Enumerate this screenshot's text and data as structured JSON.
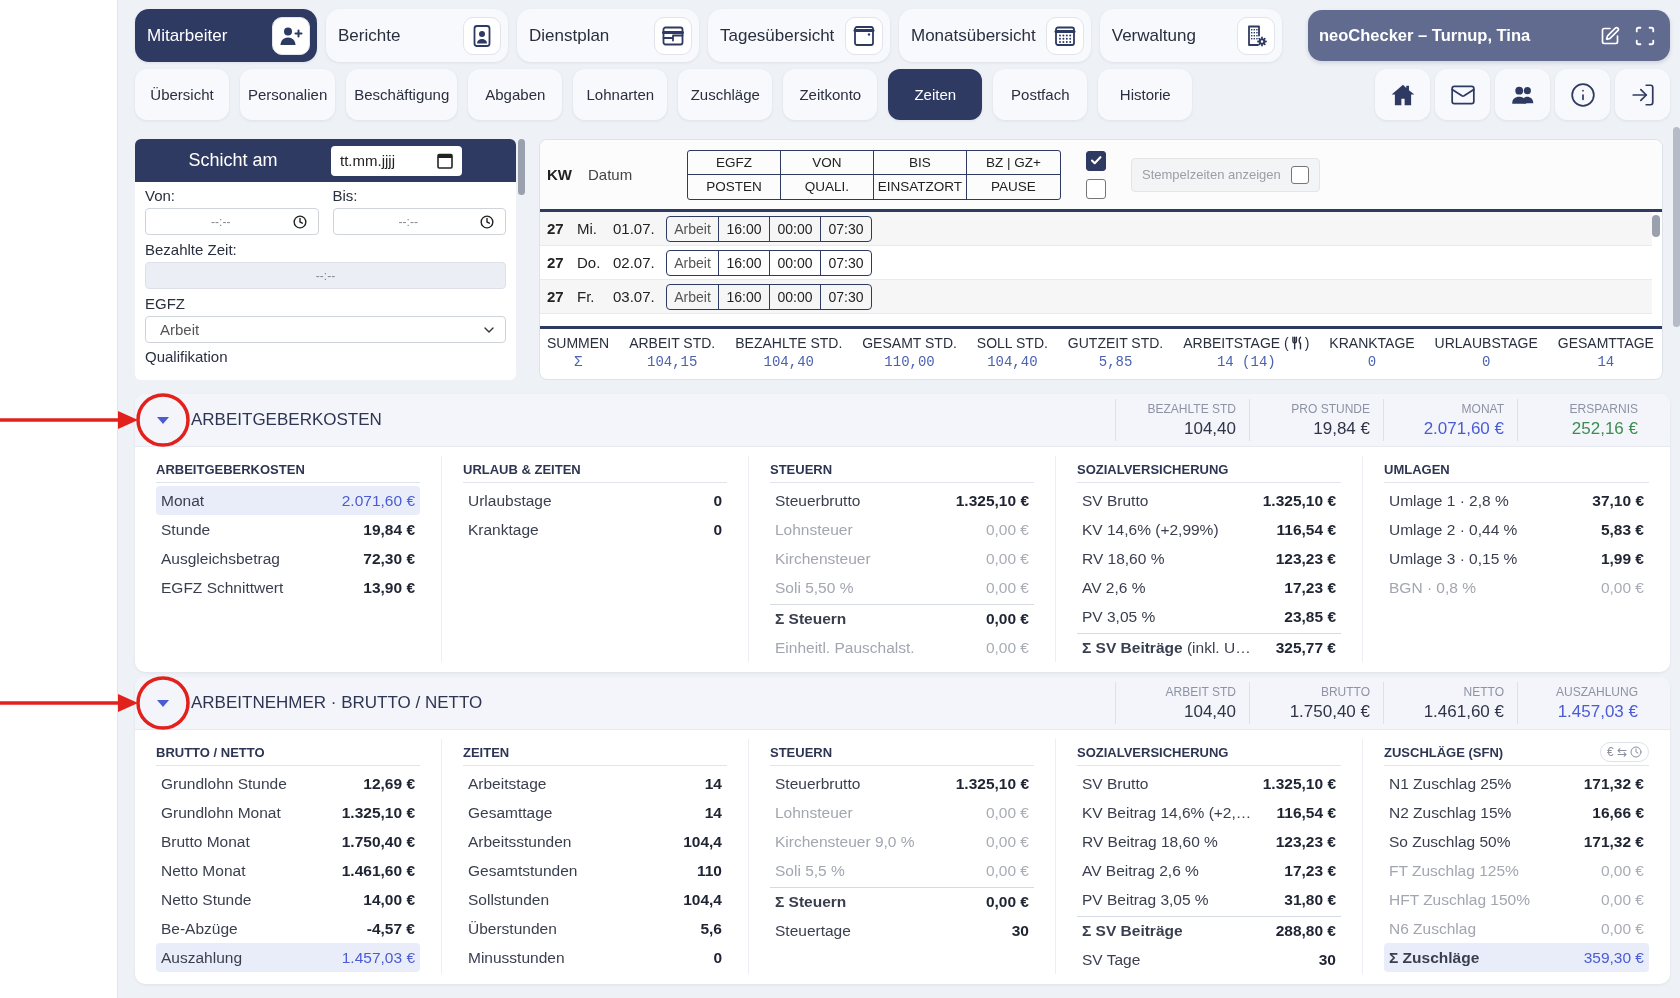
{
  "top_nav": [
    {
      "label": "Mitarbeiter",
      "selected": true
    },
    {
      "label": "Berichte",
      "selected": false
    },
    {
      "label": "Dienstplan",
      "selected": false
    },
    {
      "label": "Tagesübersicht",
      "selected": false
    },
    {
      "label": "Monatsübersicht",
      "selected": false
    },
    {
      "label": "Verwaltung",
      "selected": false
    }
  ],
  "app_panel": {
    "title": "neoChecker – Turnup, Tina"
  },
  "sub_tabs": [
    {
      "label": "Übersicht",
      "selected": false
    },
    {
      "label": "Personalien",
      "selected": false
    },
    {
      "label": "Beschäftigung",
      "selected": false
    },
    {
      "label": "Abgaben",
      "selected": false
    },
    {
      "label": "Lohnarten",
      "selected": false
    },
    {
      "label": "Zuschläge",
      "selected": false
    },
    {
      "label": "Zeitkonto",
      "selected": false
    },
    {
      "label": "Zeiten",
      "selected": true
    },
    {
      "label": "Postfach",
      "selected": false
    },
    {
      "label": "Historie",
      "selected": false
    }
  ],
  "shift_form": {
    "title": "Schicht am",
    "date": {
      "placeholder": "tt.mm.jjjj"
    },
    "from": {
      "label": "Von:",
      "placeholder": "--:--"
    },
    "to": {
      "label": "Bis:",
      "placeholder": "--:--"
    },
    "paid_time": {
      "label": "Bezahlte Zeit:",
      "placeholder": "--:--",
      "disabled": true
    },
    "egfz": {
      "label": "EGFZ",
      "value": "Arbeit"
    },
    "qualification": {
      "label": "Qualifikation"
    }
  },
  "shift_table": {
    "kw_label": "KW",
    "date_label": "Datum",
    "header_grid": [
      [
        "EGFZ",
        "VON",
        "BIS",
        "BZ | GZ+"
      ],
      [
        "POSTEN",
        "QUALI.",
        "EINSATZORT",
        "PAUSE"
      ]
    ],
    "header_checks": [
      {
        "checked": true
      },
      {
        "checked": false
      }
    ],
    "stamp_toggle": {
      "label": "Stempelzeiten anzeigen",
      "checked": false,
      "disabled": true
    },
    "rows": [
      {
        "kw": "27",
        "weekday": "Mi.",
        "date": "01.07.",
        "cells": [
          "Arbeit",
          "16:00",
          "00:00",
          "07:30"
        ]
      },
      {
        "kw": "27",
        "weekday": "Do.",
        "date": "02.07.",
        "cells": [
          "Arbeit",
          "16:00",
          "00:00",
          "07:30"
        ]
      },
      {
        "kw": "27",
        "weekday": "Fr.",
        "date": "03.07.",
        "cells": [
          "Arbeit",
          "16:00",
          "00:00",
          "07:30"
        ]
      }
    ],
    "sums": {
      "label": "SUMMEN",
      "symbol": "Σ",
      "columns": [
        {
          "label": "ARBEIT STD.",
          "value": "104,15"
        },
        {
          "label": "BEZAHLTE STD.",
          "value": "104,40"
        },
        {
          "label": "GESAMT STD.",
          "value": "110,00"
        },
        {
          "label": "SOLL STD.",
          "value": "104,40"
        },
        {
          "label": "GUTZEIT STD.",
          "value": "5,85"
        },
        {
          "label": "ARBEITSTAGE (",
          "label_end": ")",
          "has_icon": true,
          "value": "14 (14)"
        },
        {
          "label": "KRANKTAGE",
          "value": "0"
        },
        {
          "label": "URLAUBSTAGE",
          "value": "0"
        },
        {
          "label": "GESAMTTAGE",
          "value": "14"
        }
      ]
    }
  },
  "sections": [
    {
      "title": "ARBEITGEBERKOSTEN",
      "expanded": true,
      "highlighted": true,
      "summary": [
        {
          "label": "BEZAHLTE STD",
          "value": "104,40",
          "color": "#2f3447"
        },
        {
          "label": "PRO STUNDE",
          "value": "19,84 €",
          "color": "#2f3447"
        },
        {
          "label": "MONAT",
          "value": "2.071,60 €",
          "color": "#4a5bd4"
        },
        {
          "label": "ERSPARNIS",
          "value": "252,16 €",
          "color": "#3e8c4f"
        }
      ],
      "groups": [
        {
          "title": "ARBEITGEBERKOSTEN",
          "rows": [
            {
              "label": "Monat",
              "value": "2.071,60 €",
              "kind": "highlight"
            },
            {
              "label": "Stunde",
              "value": "19,84 €",
              "kind": "normal"
            },
            {
              "label": "Ausgleichsbetrag",
              "value": "72,30 €",
              "kind": "normal"
            },
            {
              "label": "EGFZ Schnittwert",
              "value": "13,90 €",
              "kind": "normal"
            }
          ]
        },
        {
          "title": "URLAUB & ZEITEN",
          "rows": [
            {
              "label": "Urlaubstage",
              "value": "0",
              "kind": "normal"
            },
            {
              "label": "Kranktage",
              "value": "0",
              "kind": "normal"
            }
          ]
        },
        {
          "title": "STEUERN",
          "rows": [
            {
              "label": "Steuerbrutto",
              "value": "1.325,10 €",
              "kind": "normal"
            },
            {
              "label": "Lohnsteuer",
              "value": "0,00 €",
              "kind": "muted"
            },
            {
              "label": "Kirchensteuer",
              "value": "0,00 €",
              "kind": "muted"
            },
            {
              "label": "Soli 5,50 %",
              "value": "0,00 €",
              "kind": "muted"
            },
            {
              "label": "Σ Steuern",
              "value": "0,00 €",
              "kind": "total"
            },
            {
              "label": "Einheitl. Pauschalst.",
              "value": "0,00 €",
              "kind": "muted"
            }
          ]
        },
        {
          "title": "SOZIALVERSICHERUNG",
          "rows": [
            {
              "label": "SV Brutto",
              "value": "1.325,10 €",
              "kind": "normal"
            },
            {
              "label": "KV 14,6% (+2,99%)",
              "value": "116,54 €",
              "kind": "normal"
            },
            {
              "label": "RV 18,60 %",
              "value": "123,23 €",
              "kind": "normal"
            },
            {
              "label": "AV 2,6 %",
              "value": "17,23 €",
              "kind": "normal"
            },
            {
              "label": "PV 3,05 %",
              "value": "23,85 €",
              "kind": "normal"
            },
            {
              "label": "Σ SV Beiträge",
              "note": "(inkl. U…",
              "value": "325,77 €",
              "kind": "total"
            }
          ]
        },
        {
          "title": "UMLAGEN",
          "rows": [
            {
              "label": "Umlage 1 · 2,8 %",
              "value": "37,10 €",
              "kind": "normal"
            },
            {
              "label": "Umlage 2 · 0,44 %",
              "value": "5,83 €",
              "kind": "normal"
            },
            {
              "label": "Umlage 3 · 0,15 %",
              "value": "1,99 €",
              "kind": "normal"
            },
            {
              "label": "BGN · 0,8 %",
              "value": "0,00 €",
              "kind": "muted"
            }
          ]
        }
      ]
    },
    {
      "title": "ARBEITNEHMER · BRUTTO / NETTO",
      "expanded": true,
      "highlighted": true,
      "summary": [
        {
          "label": "ARBEIT STD",
          "value": "104,40",
          "color": "#2f3447"
        },
        {
          "label": "BRUTTO",
          "value": "1.750,40 €",
          "color": "#2f3447"
        },
        {
          "label": "NETTO",
          "value": "1.461,60 €",
          "color": "#2f3447"
        },
        {
          "label": "AUSZAHLUNG",
          "value": "1.457,03 €",
          "color": "#4a5bd4"
        }
      ],
      "groups": [
        {
          "title": "BRUTTO / NETTO",
          "rows": [
            {
              "label": "Grundlohn Stunde",
              "value": "12,69 €",
              "kind": "normal"
            },
            {
              "label": "Grundlohn Monat",
              "value": "1.325,10 €",
              "kind": "normal"
            },
            {
              "label": "Brutto Monat",
              "value": "1.750,40 €",
              "kind": "normal"
            },
            {
              "label": "Netto Monat",
              "value": "1.461,60 €",
              "kind": "normal"
            },
            {
              "label": "Netto Stunde",
              "value": "14,00 €",
              "kind": "normal"
            },
            {
              "label": "Be-Abzüge",
              "value": "-4,57 €",
              "kind": "normal"
            },
            {
              "label": "Auszahlung",
              "value": "1.457,03 €",
              "kind": "highlight"
            }
          ]
        },
        {
          "title": "ZEITEN",
          "rows": [
            {
              "label": "Arbeitstage",
              "value": "14",
              "kind": "normal"
            },
            {
              "label": "Gesamttage",
              "value": "14",
              "kind": "normal"
            },
            {
              "label": "Arbeitsstunden",
              "value": "104,4",
              "kind": "normal"
            },
            {
              "label": "Gesamtstunden",
              "value": "110",
              "kind": "normal"
            },
            {
              "label": "Sollstunden",
              "value": "104,4",
              "kind": "normal"
            },
            {
              "label": "Überstunden",
              "value": "5,6",
              "kind": "normal"
            },
            {
              "label": "Minusstunden",
              "value": "0",
              "kind": "normal"
            }
          ]
        },
        {
          "title": "STEUERN",
          "rows": [
            {
              "label": "Steuerbrutto",
              "value": "1.325,10 €",
              "kind": "normal"
            },
            {
              "label": "Lohnsteuer",
              "value": "0,00 €",
              "kind": "muted"
            },
            {
              "label": "Kirchensteuer 9,0 %",
              "value": "0,00 €",
              "kind": "muted"
            },
            {
              "label": "Soli 5,5 %",
              "value": "0,00 €",
              "kind": "muted"
            },
            {
              "label": "Σ Steuern",
              "value": "0,00 €",
              "kind": "total"
            },
            {
              "label": "Steuertage",
              "value": "30",
              "kind": "normal"
            }
          ]
        },
        {
          "title": "SOZIALVERSICHERUNG",
          "rows": [
            {
              "label": "SV Brutto",
              "value": "1.325,10 €",
              "kind": "normal"
            },
            {
              "label": "KV Beitrag 14,6% (+2,…",
              "value": "116,54 €",
              "kind": "normal"
            },
            {
              "label": "RV Beitrag 18,60 %",
              "value": "123,23 €",
              "kind": "normal"
            },
            {
              "label": "AV Beitrag 2,6 %",
              "value": "17,23 €",
              "kind": "normal"
            },
            {
              "label": "PV Beitrag 3,05 %",
              "value": "31,80 €",
              "kind": "normal"
            },
            {
              "label": "Σ SV Beiträge",
              "value": "288,80 €",
              "kind": "total"
            },
            {
              "label": "SV Tage",
              "value": "30",
              "kind": "normal"
            }
          ]
        },
        {
          "title": "ZUSCHLÄGE (SFN)",
          "unit_toggle": {
            "left": "€",
            "middle": "⇆"
          },
          "rows": [
            {
              "label": "N1 Zuschlag 25%",
              "value": "171,32 €",
              "kind": "normal"
            },
            {
              "label": "N2 Zuschlag 15%",
              "value": "16,66 €",
              "kind": "normal"
            },
            {
              "label": "So Zuschlag 50%",
              "value": "171,32 €",
              "kind": "normal"
            },
            {
              "label": "FT Zuschlag 125%",
              "value": "0,00 €",
              "kind": "muted"
            },
            {
              "label": "HFT Zuschlag 150%",
              "value": "0,00 €",
              "kind": "muted"
            },
            {
              "label": "N6 Zuschlag",
              "value": "0,00 €",
              "kind": "muted"
            },
            {
              "label": "Σ Zuschläge",
              "value": "359,30 €",
              "kind": "highlight_total"
            }
          ]
        }
      ]
    }
  ]
}
